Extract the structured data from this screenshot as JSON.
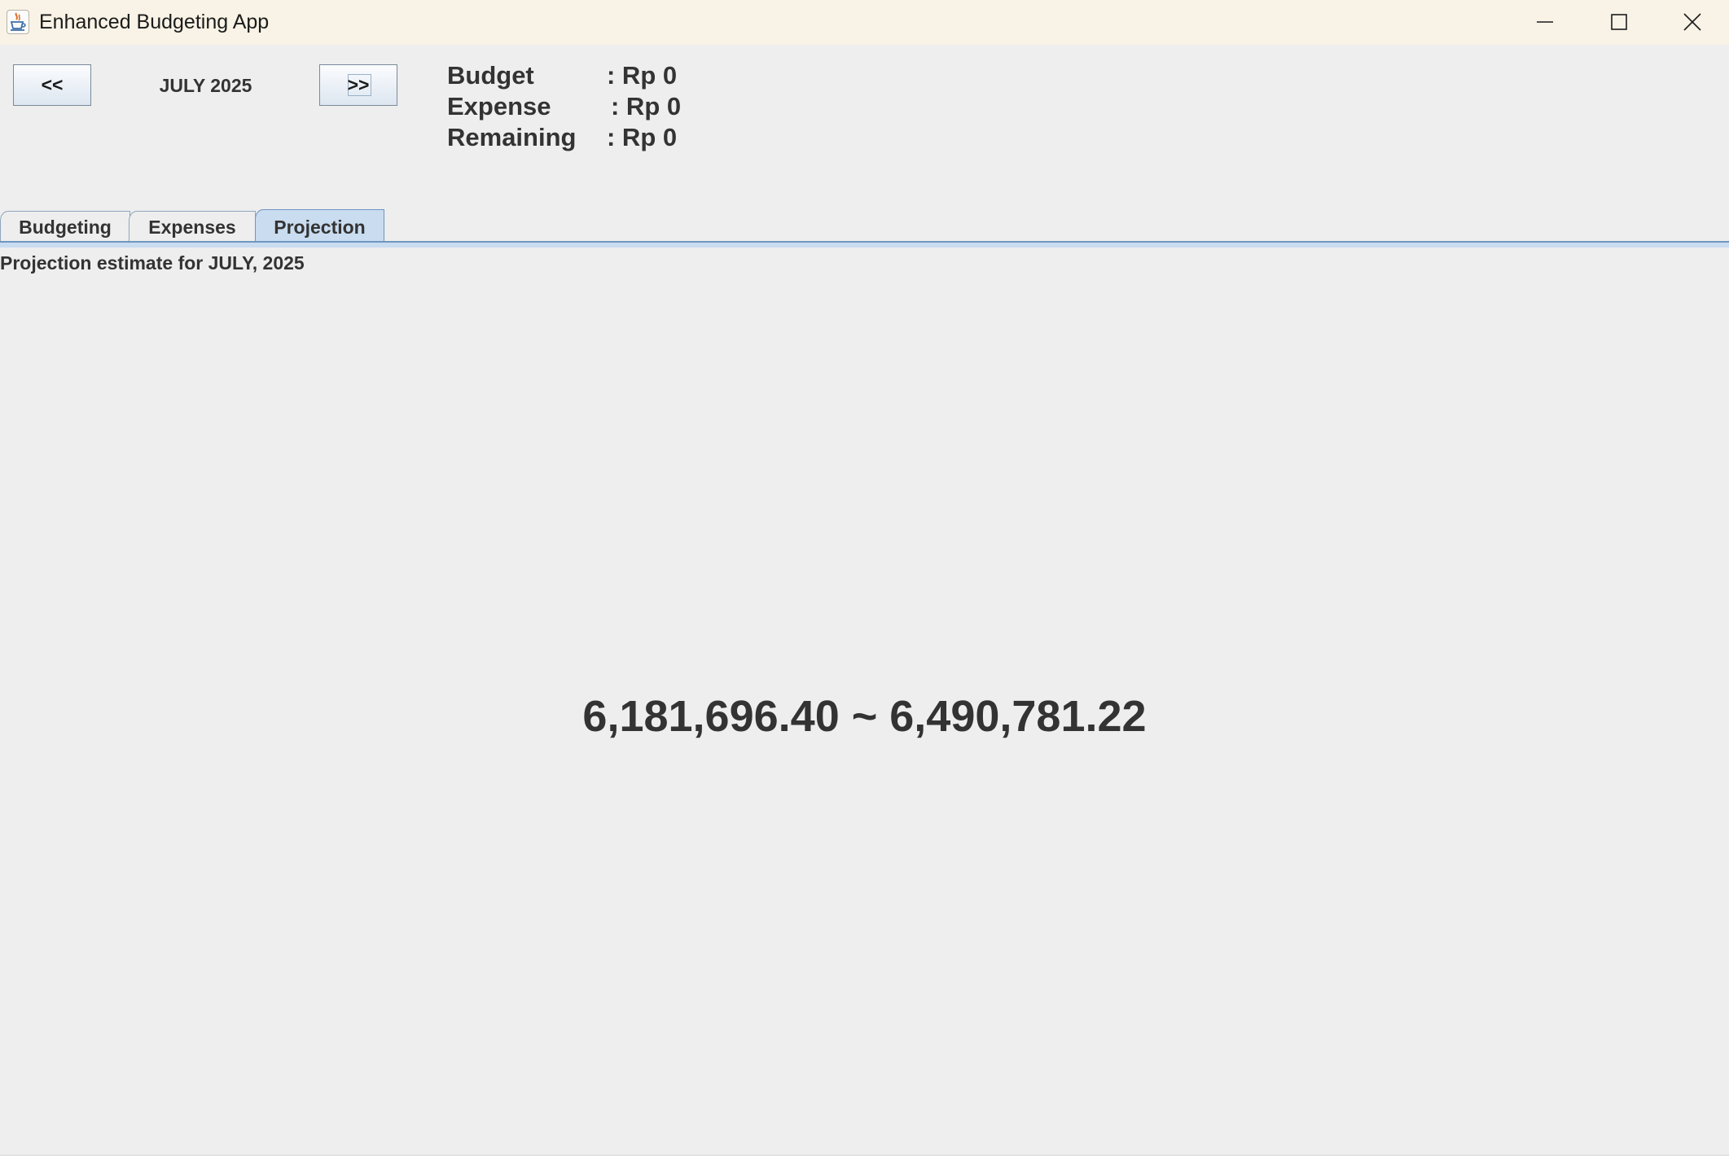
{
  "window": {
    "title": "Enhanced Budgeting App",
    "icon": "java-cup-icon",
    "controls": [
      "minimize-icon",
      "maximize-icon",
      "close-icon"
    ]
  },
  "navigation": {
    "prev_label": "<<",
    "next_label": ">>",
    "current_month": "JULY 2025"
  },
  "summary": {
    "budget_label": "Budget",
    "budget_value": ": Rp 0",
    "expense_label": "Expense",
    "expense_value": ": Rp 0",
    "remaining_label": "Remaining",
    "remaining_value": ": Rp 0"
  },
  "tabs": [
    {
      "label": "Budgeting",
      "selected": false
    },
    {
      "label": "Expenses",
      "selected": false
    },
    {
      "label": "Projection",
      "selected": true
    }
  ],
  "projection": {
    "heading": "Projection estimate for JULY, 2025",
    "value": "6,181,696.40 ~ 6,490,781.22"
  },
  "colors": {
    "titlebar": "#f8f3e6",
    "background": "#eeeeee",
    "selected_tab": "#c9dcf0",
    "tab_border": "#6f96c0",
    "text": "#333333"
  }
}
